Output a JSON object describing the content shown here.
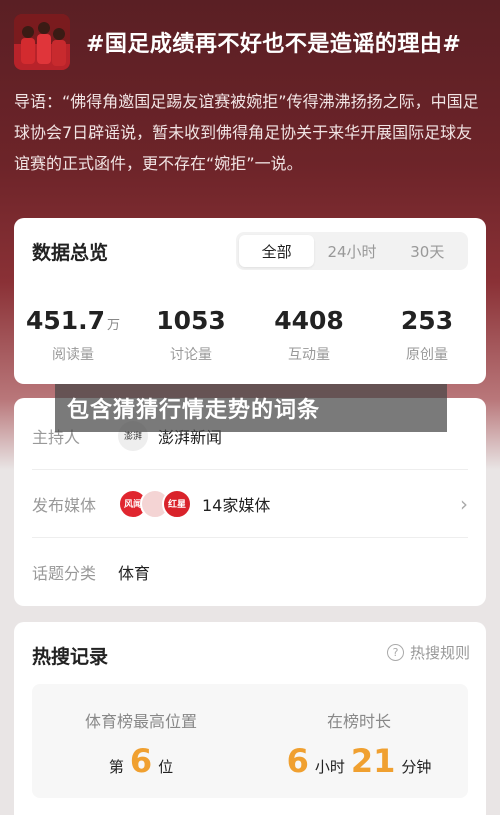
{
  "header": {
    "topic_title": "#国足成绩再不好也不是造谣的理由#",
    "lead": "导语：“佛得角邀国足踢友谊赛被婉拒”传得沸沸扬扬之际，中国足球协会7日辟谣说，暂未收到佛得角足协关于来华开展国际足球友谊赛的正式函件，更不存在“婉拒”一说。"
  },
  "data_overview": {
    "title": "数据总览",
    "tabs": [
      "全部",
      "24小时",
      "30天"
    ],
    "active_tab": "全部",
    "stats": [
      {
        "value": "451.7",
        "unit": "万",
        "label": "阅读量"
      },
      {
        "value": "1053",
        "unit": "",
        "label": "讨论量"
      },
      {
        "value": "4408",
        "unit": "",
        "label": "互动量"
      },
      {
        "value": "253",
        "unit": "",
        "label": "原创量"
      }
    ]
  },
  "banner": {
    "text": "包含猜猜行情走势的词条"
  },
  "info": {
    "host_label": "主持人",
    "host_avatar_text": "澎湃",
    "host_value": "澎湃新闻",
    "media_label": "发布媒体",
    "media_logo_1": "风闻",
    "media_logo_2": "",
    "media_logo_3": "红星",
    "media_value": "14家媒体",
    "category_label": "话题分类",
    "category_value": "体育"
  },
  "hot_search": {
    "title": "热搜记录",
    "rules_label": "热搜规则",
    "rank_label": "体育榜最高位置",
    "rank_prefix": "第",
    "rank_value": "6",
    "rank_suffix": "位",
    "duration_label": "在榜时长",
    "hours_value": "6",
    "hours_unit": "小时",
    "minutes_value": "21",
    "minutes_unit": "分钟"
  },
  "colors": {
    "hero_dark": "#5a1f24",
    "accent_orange": "#f0a030",
    "media_red": "#e0262f"
  }
}
